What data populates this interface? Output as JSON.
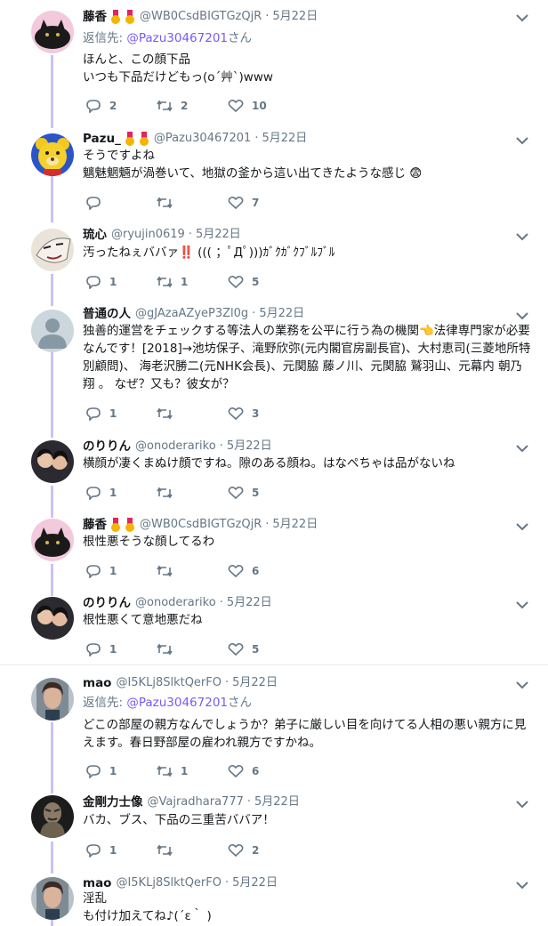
{
  "colors": {
    "thread": "#c9c2f5",
    "link": "#7a5af8",
    "muted": "#657786"
  },
  "tweets": [
    {
      "name": "藤香",
      "badges": 2,
      "handle": "@WB0CsdBIGTGzQjR",
      "date": "5月22日",
      "reply_prefix": "返信先: ",
      "reply_mention": "@Pazu30467201",
      "reply_suffix": "さん",
      "text": "ほんと、この顔下品\nいつも下品だけどもっ(o´艸`)www",
      "replies": "2",
      "retweets": "2",
      "likes": "10",
      "avatar_icon": "black-cat-avatar"
    },
    {
      "name": "Pazu_",
      "badges": 2,
      "handle": "@Pazu30467201",
      "date": "5月22日",
      "text": "そうですよね\n魑魅魍魎が渦巻いて、地獄の釜から這い出てきたような感じ 😨",
      "replies": "",
      "retweets": "",
      "likes": "7",
      "avatar_icon": "teddy-bear-avatar"
    },
    {
      "name": "琉心",
      "badges": 0,
      "handle": "@ryujin0619",
      "date": "5月22日",
      "text": "汚ったねぇババァ‼️ ((( ；ﾟДﾟ)))ｶﾞｸｶﾞｸﾌﾞﾙﾌﾞﾙ",
      "replies": "1",
      "retweets": "1",
      "likes": "5",
      "avatar_icon": "mask-avatar"
    },
    {
      "name": "普通の人",
      "badges": 0,
      "handle": "@gJAzaAZyeP3Zl0g",
      "date": "5月22日",
      "text": "独善的運営をチェックする等法人の業務を公平に行う為の機関👈法律専門家が必要なんです！[2018]→池坊保子、滝野欣弥(元内閣官房副長官)、大村恵司(三菱地所特別顧問)、 海老沢勝二(元NHK会長)、元関脇 藤ノ川、元関脇 鷲羽山、元幕内 朝乃翔 。 なぜ？又も？彼女が？",
      "replies": "1",
      "retweets": "",
      "likes": "3",
      "avatar_icon": "default-profile-avatar"
    },
    {
      "name": "のりりん",
      "badges": 0,
      "handle": "@onoderariko",
      "date": "5月22日",
      "text": "横顔が凄くまぬけ顔ですね。隙のある顔ね。はなぺちゃは品がないね",
      "replies": "1",
      "retweets": "",
      "likes": "5",
      "avatar_icon": "couple-photo-avatar"
    },
    {
      "name": "藤香",
      "badges": 2,
      "handle": "@WB0CsdBIGTGzQjR",
      "date": "5月22日",
      "text": "根性悪そうな顔してるわ",
      "replies": "1",
      "retweets": "",
      "likes": "6",
      "avatar_icon": "black-cat-avatar"
    },
    {
      "name": "のりりん",
      "badges": 0,
      "handle": "@onoderariko",
      "date": "5月22日",
      "text": "根性悪くて意地悪だね",
      "replies": "1",
      "retweets": "",
      "likes": "5",
      "avatar_icon": "couple-photo-avatar"
    },
    {
      "name": "mao",
      "badges": 0,
      "handle": "@I5KLj8SlktQerFO",
      "date": "5月22日",
      "reply_prefix": "返信先: ",
      "reply_mention": "@Pazu30467201",
      "reply_suffix": "さん",
      "text": "どこの部屋の親方なんでしょうか？弟子に厳しい目を向けてる人相の悪い親方に見えます。春日野部屋の雇われ親方ですかね。",
      "replies": "1",
      "retweets": "1",
      "likes": "6",
      "avatar_icon": "portrait-avatar"
    },
    {
      "name": "金剛力士像",
      "badges": 0,
      "handle": "@Vajradhara777",
      "date": "5月22日",
      "text": "バカ、ブス、下品の三重苦ババア！",
      "replies": "1",
      "retweets": "",
      "likes": "2",
      "avatar_icon": "statue-avatar"
    },
    {
      "name": "mao",
      "badges": 0,
      "handle": "@I5KLj8SlktQerFO",
      "date": "5月22日",
      "text": "淫乱\nも付け加えてね♪(´ε｀ )",
      "replies": "",
      "retweets": "",
      "likes": "",
      "avatar_icon": "portrait-avatar"
    }
  ]
}
